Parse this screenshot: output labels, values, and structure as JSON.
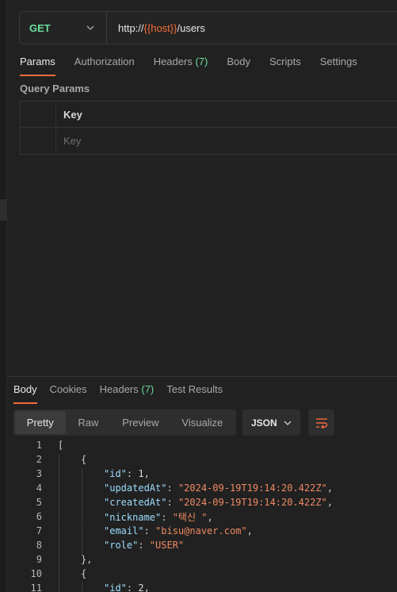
{
  "request": {
    "method": "GET",
    "url_prefix": "http://",
    "url_variable": "{{host}}",
    "url_suffix": "/users"
  },
  "request_tabs": [
    {
      "label": "Params",
      "count": ""
    },
    {
      "label": "Authorization",
      "count": ""
    },
    {
      "label": "Headers",
      "count": "(7)"
    },
    {
      "label": "Body",
      "count": ""
    },
    {
      "label": "Scripts",
      "count": ""
    },
    {
      "label": "Settings",
      "count": ""
    }
  ],
  "query_params": {
    "title": "Query Params",
    "column_key": "Key",
    "key_placeholder": "Key"
  },
  "response_tabs": [
    {
      "label": "Body",
      "count": ""
    },
    {
      "label": "Cookies",
      "count": ""
    },
    {
      "label": "Headers",
      "count": "(7)"
    },
    {
      "label": "Test Results",
      "count": ""
    }
  ],
  "view_modes": [
    "Pretty",
    "Raw",
    "Preview",
    "Visualize"
  ],
  "format": "JSON",
  "code_lines": [
    {
      "num": "1",
      "indent": 0,
      "text": "["
    },
    {
      "num": "2",
      "indent": 1,
      "text": "{"
    },
    {
      "num": "3",
      "indent": 2,
      "key": "\"id\"",
      "value": "1",
      "vtype": "n",
      "comma": true
    },
    {
      "num": "4",
      "indent": 2,
      "key": "\"updatedAt\"",
      "value": "\"2024-09-19T19:14:20.422Z\"",
      "vtype": "s",
      "comma": true
    },
    {
      "num": "5",
      "indent": 2,
      "key": "\"createdAt\"",
      "value": "\"2024-09-19T19:14:20.422Z\"",
      "vtype": "s",
      "comma": true
    },
    {
      "num": "6",
      "indent": 2,
      "key": "\"nickname\"",
      "value": "\"택신 \"",
      "vtype": "s",
      "comma": true
    },
    {
      "num": "7",
      "indent": 2,
      "key": "\"email\"",
      "value": "\"bisu@naver.com\"",
      "vtype": "s",
      "comma": true
    },
    {
      "num": "8",
      "indent": 2,
      "key": "\"role\"",
      "value": "\"USER\"",
      "vtype": "s",
      "comma": false
    },
    {
      "num": "9",
      "indent": 1,
      "text": "},"
    },
    {
      "num": "10",
      "indent": 1,
      "text": "{"
    },
    {
      "num": "11",
      "indent": 2,
      "key": "\"id\"",
      "value": "2",
      "vtype": "n",
      "comma": true
    }
  ],
  "colors": {
    "accent": "#f26b3a",
    "method_get": "#6bdd9a",
    "json_key": "#9cdcfe",
    "json_string": "#ef8a62"
  }
}
